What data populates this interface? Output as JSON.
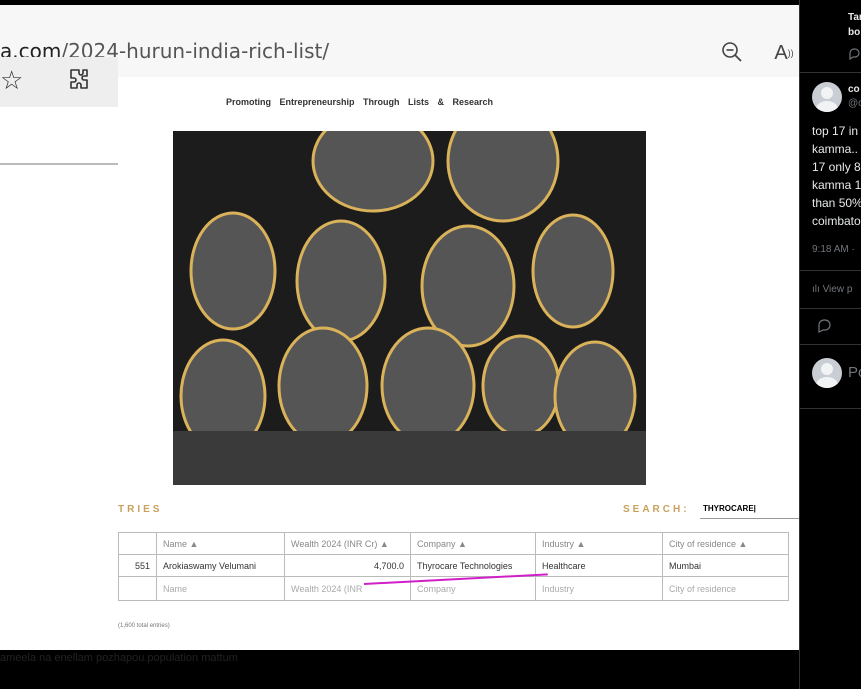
{
  "browser": {
    "url_domain": "a.com",
    "url_path": "/2024-hurun-india-rich-list/",
    "icons": [
      "zoom-out-icon",
      "read-aloud-icon",
      "star-icon",
      "extensions-icon"
    ]
  },
  "site": {
    "tagline": "Promoting Entrepreneurship   Through Lists & Research"
  },
  "list": {
    "section_label": "TRIES",
    "search_label": "SEARCH:",
    "search_value": "THYROCARE|",
    "columns": [
      "",
      "Name ▲",
      "Wealth 2024 (INR Cr) ▲",
      "Company ▲",
      "Industry ▲",
      "City of residence ▲"
    ],
    "rows": [
      [
        "551",
        "Arokiaswamy Velumani",
        "4,700.0",
        "Thyrocare Technologies",
        "Healthcare",
        "Mumbai"
      ]
    ],
    "filter_placeholders": [
      "",
      "Name",
      "Wealth 2024 (INR",
      "Company",
      "Industry",
      "City of residence"
    ],
    "footer": "(1,600 total entries)"
  },
  "caption": "ameela na enellam pozhapou.population mattum",
  "sidebar": {
    "reply_fragment_1": "Tar",
    "reply_fragment_2": "bo",
    "user_name": "co",
    "user_handle": "@c",
    "tweet_lines": [
      "top 17 in",
      "kamma..",
      "17 only 8",
      "kamma 1",
      "than 50%",
      "coimbato"
    ],
    "timestamp": "9:18 AM ·",
    "views": "View p",
    "post_placeholder": "Po"
  }
}
